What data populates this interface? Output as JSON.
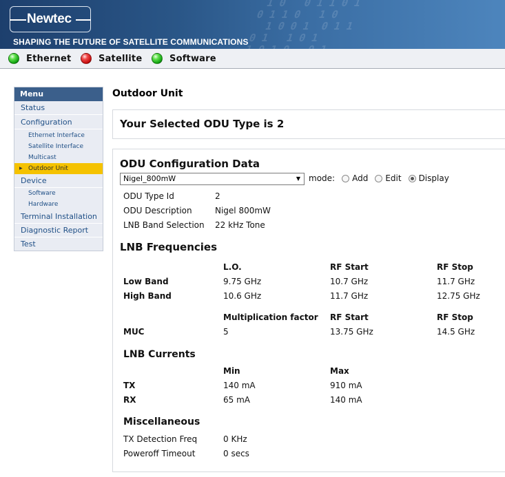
{
  "header": {
    "logo_text": "Newtec",
    "tagline": "SHAPING THE FUTURE OF SATELLITE COMMUNICATIONS"
  },
  "status": [
    {
      "label": "Ethernet",
      "state": "ok",
      "color": "#1fb51f"
    },
    {
      "label": "Satellite",
      "state": "alarm",
      "color": "#d61a1a"
    },
    {
      "label": "Software",
      "state": "ok",
      "color": "#1fb51f"
    }
  ],
  "menu": {
    "title": "Menu",
    "items": {
      "status": "Status",
      "configuration": "Configuration",
      "ethernet_interface": "Ethernet Interface",
      "satellite_interface": "Satellite Interface",
      "multicast": "Multicast",
      "outdoor_unit": "Outdoor Unit",
      "device": "Device",
      "software": "Software",
      "hardware": "Hardware",
      "terminal_installation": "Terminal Installation",
      "diagnostic_report": "Diagnostic Report",
      "test": "Test"
    },
    "active": "Outdoor Unit"
  },
  "main": {
    "page_title": "Outdoor Unit",
    "selected_type_text": "Your Selected ODU Type is 2",
    "config": {
      "title": "ODU Configuration Data",
      "select_value": "Nigel_800mW",
      "mode_label": "mode:",
      "modes": [
        "Add",
        "Edit",
        "Display"
      ],
      "selected_mode": "Display",
      "fields": [
        {
          "label": "ODU Type Id",
          "value": "2"
        },
        {
          "label": "ODU Description",
          "value": "Nigel 800mW"
        },
        {
          "label": "LNB Band Selection",
          "value": "22 kHz Tone"
        }
      ]
    },
    "lnb_frequencies": {
      "title": "LNB Frequencies",
      "headers": [
        "L.O.",
        "RF Start",
        "RF Stop"
      ],
      "rows": [
        {
          "label": "Low Band",
          "values": [
            "9.75 GHz",
            "10.7 GHz",
            "11.7 GHz"
          ]
        },
        {
          "label": "High Band",
          "values": [
            "10.6 GHz",
            "11.7 GHz",
            "12.75 GHz"
          ]
        }
      ],
      "muc_headers": [
        "Multiplication factor",
        "RF Start",
        "RF Stop"
      ],
      "muc_row": {
        "label": "MUC",
        "values": [
          "5",
          "13.75 GHz",
          "14.5 GHz"
        ]
      }
    },
    "lnb_currents": {
      "title": "LNB Currents",
      "headers": [
        "Min",
        "Max"
      ],
      "rows": [
        {
          "label": "TX",
          "values": [
            "140 mA",
            "910 mA"
          ]
        },
        {
          "label": "RX",
          "values": [
            "65 mA",
            "140 mA"
          ]
        }
      ]
    },
    "misc": {
      "title": "Miscellaneous",
      "rows": [
        {
          "label": "TX Detection Freq",
          "value": "0 KHz"
        },
        {
          "label": "Poweroff Timeout",
          "value": "0 secs"
        }
      ]
    }
  }
}
